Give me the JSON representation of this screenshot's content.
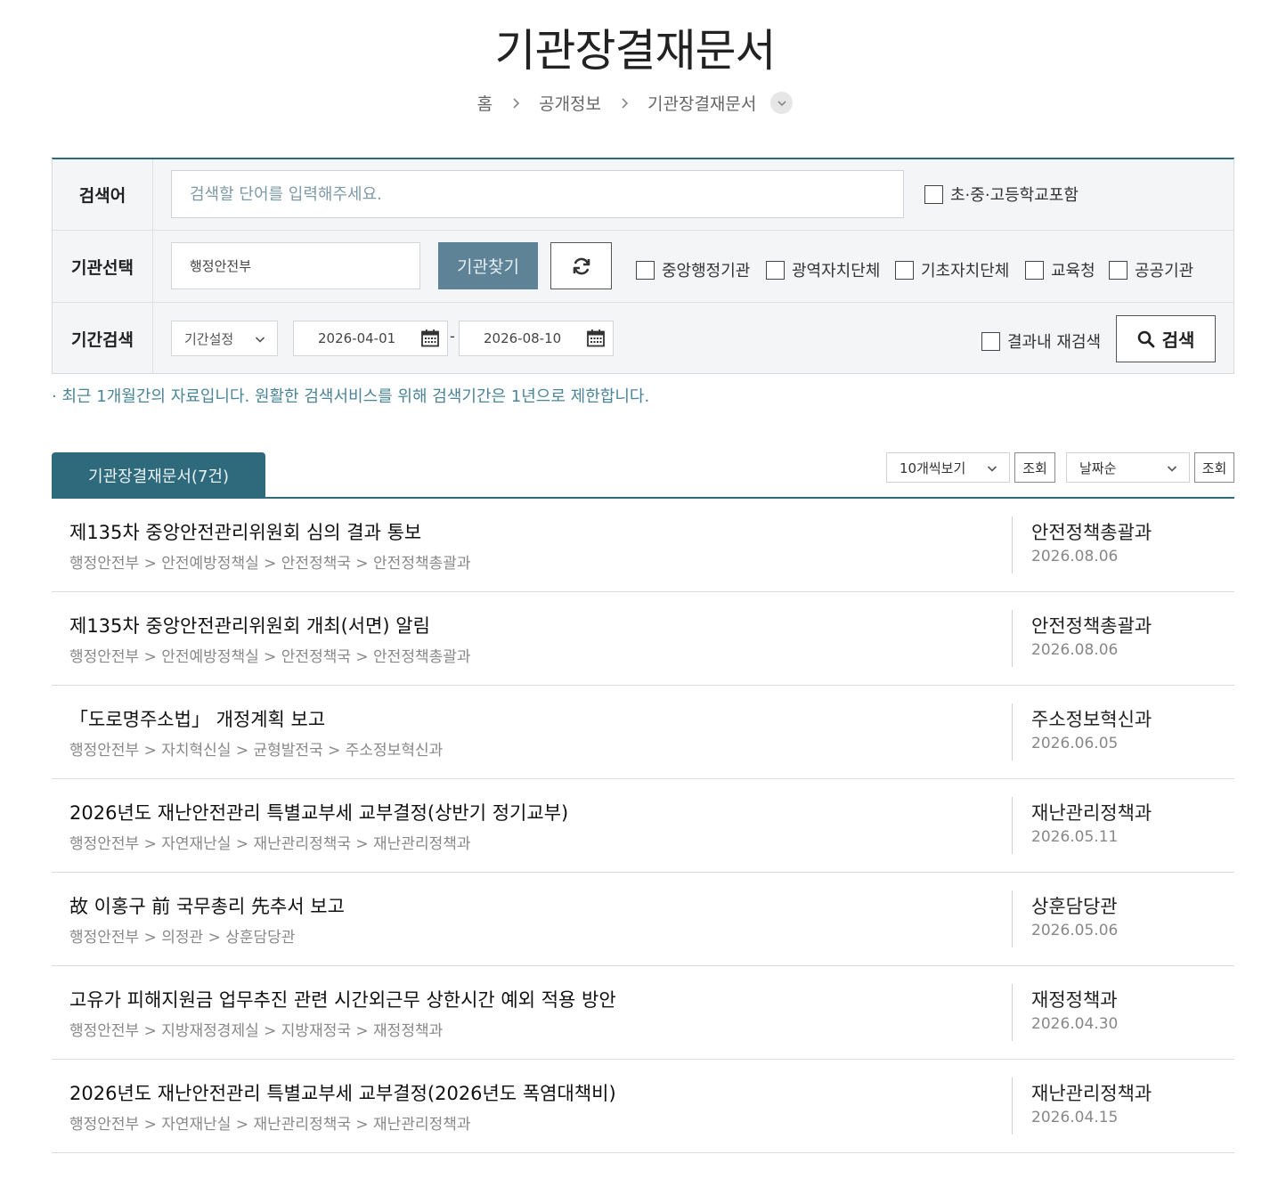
{
  "page": {
    "title": "기관장결재문서"
  },
  "breadcrumb": {
    "items": [
      "홈",
      "공개정보",
      "기관장결재문서"
    ]
  },
  "search": {
    "keyword_label": "검색어",
    "keyword_placeholder": "검색할 단어를 입력해주세요.",
    "keyword_value": "",
    "school_checkbox": "초·중·고등학교포함",
    "org_label": "기관선택",
    "org_value": "행정안전부",
    "org_find_button": "기관찾기",
    "org_types": [
      "중앙행정기관",
      "광역자치단체",
      "기초자치단체",
      "교육청",
      "공공기관"
    ],
    "period_label": "기간검색",
    "period_select": "기간설정",
    "date_from": "2026-04-01",
    "date_to": "2026-08-10",
    "date_separator": "-",
    "research_checkbox": "결과내 재검색",
    "search_button": "검색"
  },
  "notice": "· 최근 1개월간의 자료입니다. 원활한 검색서비스를 위해 검색기간은 1년으로 제한합니다.",
  "list_controls": {
    "tab_label": "기관장결재문서(7건)",
    "page_size_select": "10개씩보기",
    "sort_select": "날짜순",
    "apply_button": "조회"
  },
  "results": [
    {
      "title": "제135차 중앙안전관리위원회 심의 결과 통보",
      "path": "행정안전부 > 안전예방정책실 > 안전정책국 > 안전정책총괄과",
      "dept": "안전정책총괄과",
      "date": "2026.08.06"
    },
    {
      "title": "제135차 중앙안전관리위원회 개최(서면) 알림",
      "path": "행정안전부 > 안전예방정책실 > 안전정책국 > 안전정책총괄과",
      "dept": "안전정책총괄과",
      "date": "2026.08.06"
    },
    {
      "title": "「도로명주소법」 개정계획 보고",
      "path": "행정안전부 > 자치혁신실 > 균형발전국 > 주소정보혁신과",
      "dept": "주소정보혁신과",
      "date": "2026.06.05"
    },
    {
      "title": "2026년도 재난안전관리 특별교부세 교부결정(상반기 정기교부)",
      "path": "행정안전부 > 자연재난실 > 재난관리정책국 > 재난관리정책과",
      "dept": "재난관리정책과",
      "date": "2026.05.11"
    },
    {
      "title": "故 이홍구 前 국무총리 先추서 보고",
      "path": "행정안전부 > 의정관 > 상훈담당관",
      "dept": "상훈담당관",
      "date": "2026.05.06"
    },
    {
      "title": "고유가 피해지원금 업무추진 관련 시간외근무 상한시간 예외 적용 방안",
      "path": "행정안전부 > 지방재정경제실 > 지방재정국 > 재정정책과",
      "dept": "재정정책과",
      "date": "2026.04.30"
    },
    {
      "title": "2026년도 재난안전관리 특별교부세 교부결정(2026년도 폭염대책비)",
      "path": "행정안전부 > 자연재난실 > 재난관리정책국 > 재난관리정책과",
      "dept": "재난관리정책과",
      "date": "2026.04.15"
    }
  ],
  "colors": {
    "accent": "#2f6a7c",
    "button_muted": "#5e8296",
    "notice_text": "#4a8497"
  }
}
